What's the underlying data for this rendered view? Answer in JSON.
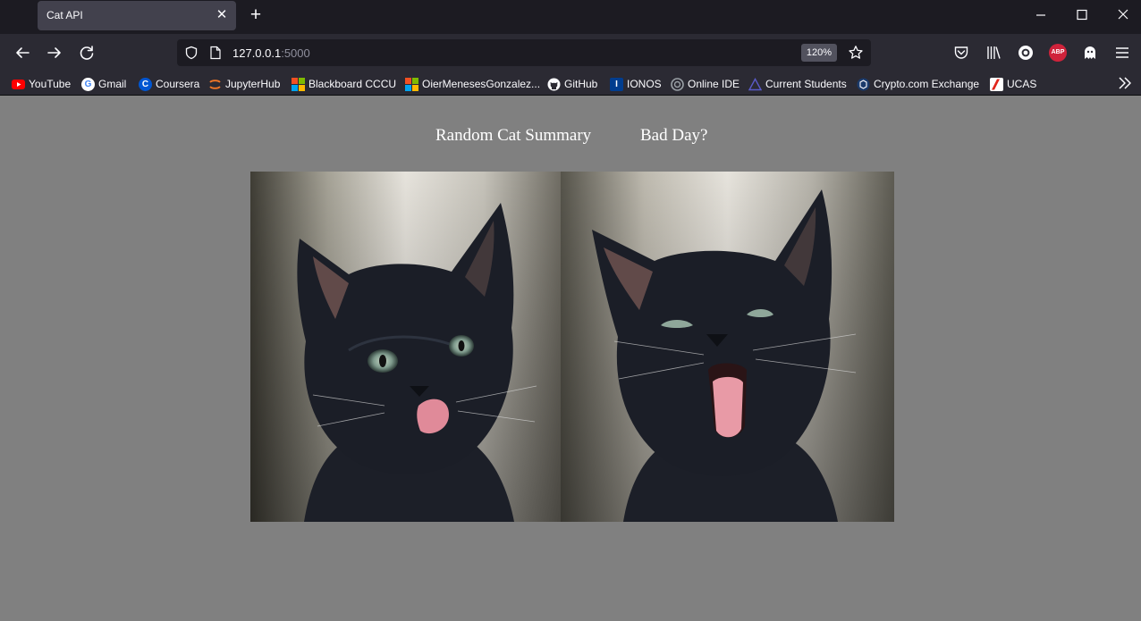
{
  "browser": {
    "tab": {
      "title": "Cat API",
      "close_glyph": "✕"
    },
    "new_tab_glyph": "+",
    "url": {
      "host": "127.0.0.1",
      "port": ":5000"
    },
    "zoom": "120%",
    "icons": [
      "back-icon",
      "forward-icon",
      "reload-icon",
      "shield-icon",
      "page-icon",
      "star-icon",
      "pocket-icon",
      "library-icon",
      "profile-icon",
      "adblock-icon",
      "ghost-icon",
      "menu-icon",
      "minimize-icon",
      "maximize-icon",
      "window-close-icon",
      "bookmarks-overflow-icon"
    ],
    "adblock_label": "ABP"
  },
  "bookmarks": [
    {
      "label": "YouTube",
      "icon": "youtube-icon",
      "color": "#ff0000"
    },
    {
      "label": "Gmail",
      "icon": "google-icon",
      "color": "#ffffff"
    },
    {
      "label": "Coursera",
      "icon": "coursera-icon",
      "color": "#0056d2"
    },
    {
      "label": "JupyterHub",
      "icon": "jupyter-icon",
      "color": "#f37726"
    },
    {
      "label": "Blackboard CCCU",
      "icon": "microsoft-icon",
      "color": "#f25022"
    },
    {
      "label": "OierMenesesGonzalez...",
      "icon": "microsoft-icon",
      "color": "#f25022"
    },
    {
      "label": "GitHub",
      "icon": "github-icon",
      "color": "#ffffff"
    },
    {
      "label": "IONOS",
      "icon": "ionos-icon",
      "color": "#003d8f"
    },
    {
      "label": "Online IDE",
      "icon": "online-ide-icon",
      "color": "#9aa0a6"
    },
    {
      "label": "Current Students",
      "icon": "students-icon",
      "color": "#3a3a8c"
    },
    {
      "label": "Crypto.com Exchange",
      "icon": "crypto-icon",
      "color": "#1a3a6b"
    },
    {
      "label": "UCAS",
      "icon": "ucas-icon",
      "color": "#e1251b"
    }
  ],
  "page": {
    "nav": {
      "random_cat_summary": "Random Cat Summary",
      "bad_day": "Bad Day?"
    },
    "images": [
      {
        "name": "cat-licking-image",
        "description_icon": "black-kitten-licking-icon"
      },
      {
        "name": "cat-yawning-image",
        "description_icon": "black-kitten-yawning-icon"
      }
    ],
    "background_color": "#808080"
  }
}
